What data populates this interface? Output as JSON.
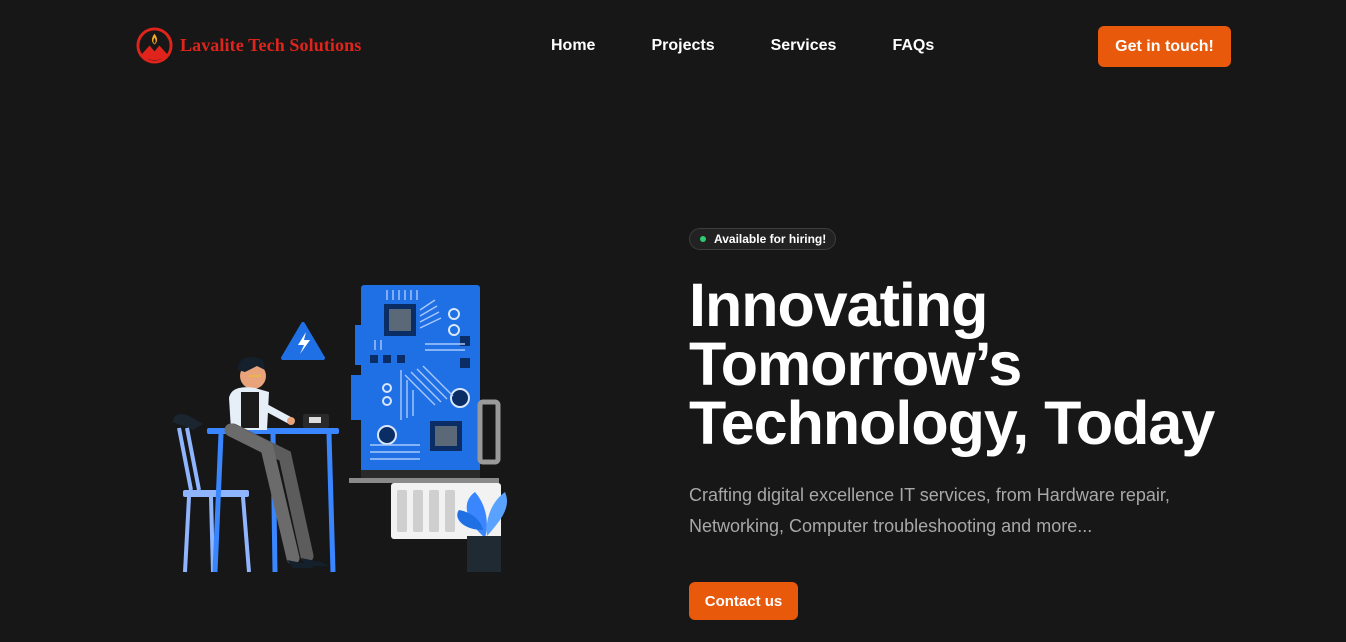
{
  "brand": {
    "name": "Lavalite Tech Solutions",
    "logo_icon": "flame-logo-icon"
  },
  "nav": {
    "links": [
      "Home",
      "Projects",
      "Services",
      "FAQs"
    ],
    "cta_label": "Get in touch!"
  },
  "hero": {
    "badge": "Available for hiring!",
    "headline": [
      "Innovating",
      "Tomorrow’s",
      "Technology, Today"
    ],
    "subtitle": "Crafting digital excellence IT services, from Hardware repair, Networking, Computer troubleshooting and more...",
    "cta_label": "Contact us"
  },
  "colors": {
    "background": "#171717",
    "accent": "#e8590c",
    "brand_red": "#e0241b",
    "board_blue": "#1f6fe5",
    "status_green": "#2ecc71"
  }
}
